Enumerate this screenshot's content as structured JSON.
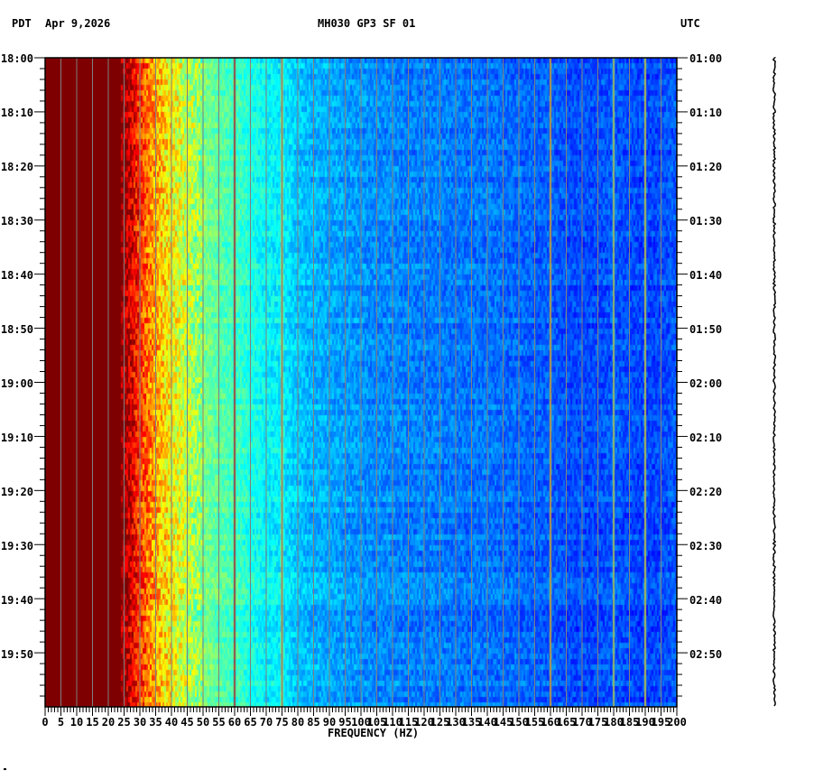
{
  "header": {
    "left_tz": "PDT",
    "date": "Apr 9,2026",
    "title": "MH030 GP3 SF 01",
    "right_tz": "UTC"
  },
  "chart_data": {
    "type": "heatmap",
    "title": "MH030 GP3 SF 01",
    "xlabel": "FREQUENCY (HZ)",
    "xlim": [
      0,
      200
    ],
    "x_ticks": [
      0,
      5,
      10,
      15,
      20,
      25,
      30,
      35,
      40,
      45,
      50,
      55,
      60,
      65,
      70,
      75,
      80,
      85,
      90,
      95,
      100,
      105,
      110,
      115,
      120,
      125,
      130,
      135,
      140,
      145,
      150,
      155,
      160,
      165,
      170,
      175,
      180,
      185,
      190,
      195,
      200
    ],
    "y_minutes_range": [
      0,
      120
    ],
    "left_time_labels": [
      "18:00",
      "18:10",
      "18:20",
      "18:30",
      "18:40",
      "18:50",
      "19:00",
      "19:10",
      "19:20",
      "19:30",
      "19:40",
      "19:50"
    ],
    "right_time_labels": [
      "01:00",
      "01:10",
      "01:20",
      "01:30",
      "01:40",
      "01:50",
      "02:00",
      "02:10",
      "02:20",
      "02:30",
      "02:40",
      "02:50"
    ],
    "colormap": "jet",
    "grid": "vertical lines every 5 Hz",
    "mean_power_profile_hz_step5": [
      1.0,
      1.0,
      1.0,
      1.0,
      1.0,
      0.97,
      0.82,
      0.7,
      0.62,
      0.56,
      0.5,
      0.46,
      0.44,
      0.4,
      0.37,
      0.36,
      0.32,
      0.3,
      0.29,
      0.28,
      0.27,
      0.26,
      0.26,
      0.25,
      0.25,
      0.25,
      0.24,
      0.24,
      0.24,
      0.23,
      0.23,
      0.22,
      0.22,
      0.2,
      0.2,
      0.2,
      0.21,
      0.2,
      0.19,
      0.2,
      0.21
    ],
    "line_features_hz": [
      {
        "hz": 60,
        "level": 0.95
      },
      {
        "hz": 75,
        "level": 0.7
      },
      {
        "hz": 160,
        "level": 0.7
      },
      {
        "hz": 180,
        "level": 0.55
      },
      {
        "hz": 190,
        "level": 0.6
      }
    ]
  }
}
